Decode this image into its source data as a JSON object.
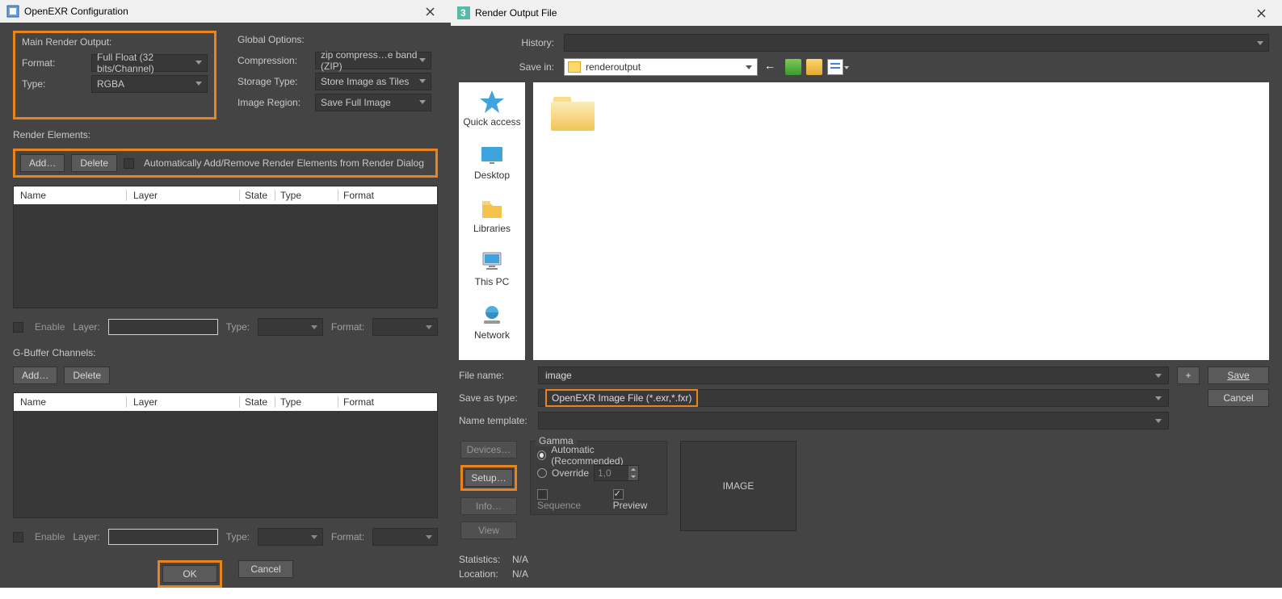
{
  "left": {
    "title": "OpenEXR Configuration",
    "mainOutput": {
      "heading": "Main Render Output:",
      "formatLabel": "Format:",
      "formatValue": "Full Float (32 bits/Channel)",
      "typeLabel": "Type:",
      "typeValue": "RGBA"
    },
    "global": {
      "heading": "Global Options:",
      "compressionLabel": "Compression:",
      "compressionValue": "zip compress…e band (ZIP)",
      "storageLabel": "Storage Type:",
      "storageValue": "Store Image as Tiles",
      "regionLabel": "Image Region:",
      "regionValue": "Save Full Image"
    },
    "renderElements": {
      "heading": "Render Elements:",
      "add": "Add…",
      "delete": "Delete",
      "autoChk": "Automatically Add/Remove Render Elements from Render Dialog",
      "cols": {
        "name": "Name",
        "layer": "Layer",
        "state": "State",
        "type": "Type",
        "format": "Format"
      },
      "enable": "Enable",
      "layer": "Layer:",
      "type": "Type:",
      "format": "Format:"
    },
    "gbuffer": {
      "heading": "G-Buffer Channels:",
      "add": "Add…",
      "delete": "Delete",
      "cols": {
        "name": "Name",
        "layer": "Layer",
        "state": "State",
        "type": "Type",
        "format": "Format"
      },
      "enable": "Enable",
      "layer": "Layer:",
      "type": "Type:",
      "format": "Format:"
    },
    "ok": "OK",
    "cancel": "Cancel"
  },
  "right": {
    "title": "Render Output File",
    "historyLabel": "History:",
    "saveInLabel": "Save in:",
    "saveInValue": "renderoutput",
    "places": [
      "Quick access",
      "Desktop",
      "Libraries",
      "This PC",
      "Network"
    ],
    "fileNameLabel": "File name:",
    "fileNameValue": "image",
    "saveTypeLabel": "Save as type:",
    "saveTypeValue": "OpenEXR Image File (*.exr,*.fxr)",
    "nameTplLabel": "Name template:",
    "plus": "+",
    "save": "Save",
    "cancel": "Cancel",
    "btns": {
      "devices": "Devices…",
      "setup": "Setup…",
      "info": "Info…",
      "view": "View"
    },
    "gamma": {
      "heading": "Gamma",
      "auto": "Automatic (Recommended)",
      "override": "Override",
      "overrideVal": "1,0"
    },
    "sequence": "Sequence",
    "preview": "Preview",
    "imageLabel": "IMAGE",
    "stats": {
      "statsLabel": "Statistics:",
      "statsVal": "N/A",
      "locLabel": "Location:",
      "locVal": "N/A"
    }
  }
}
